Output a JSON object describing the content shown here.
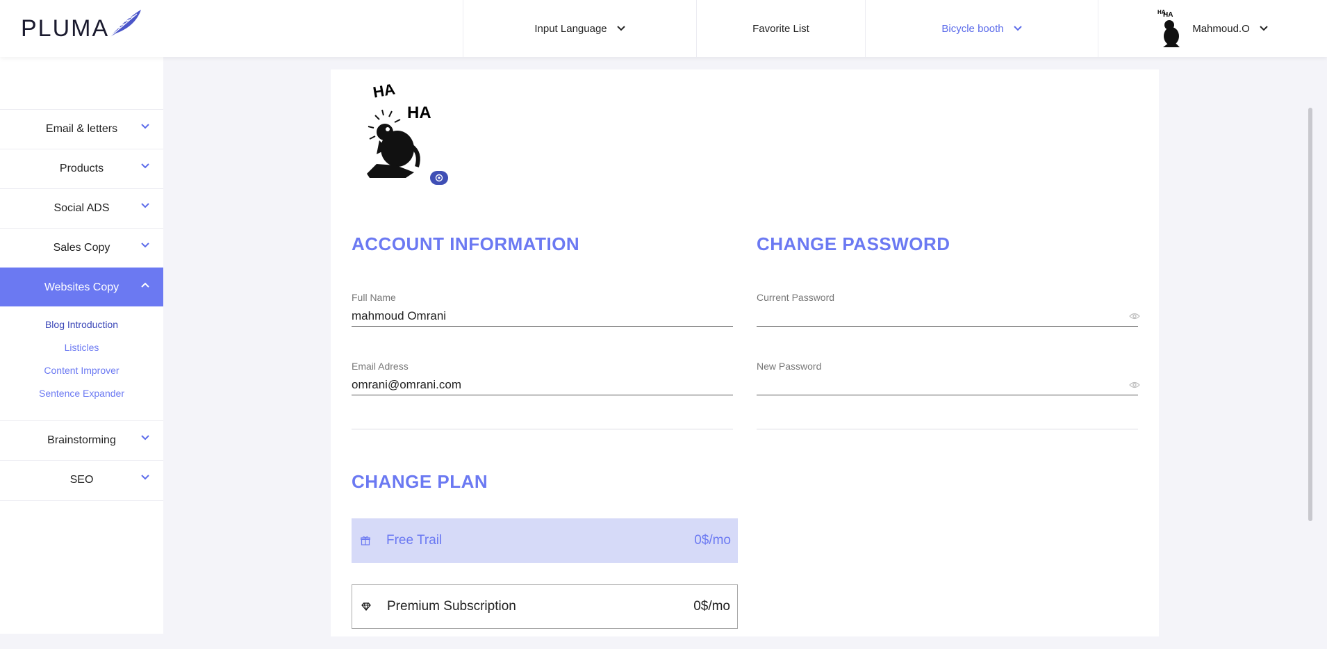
{
  "app": {
    "logo_text": "PLUMA"
  },
  "header": {
    "input_language": "Input Language",
    "favorite_list": "Favorite List",
    "bicycle_booth": "Bicycle booth",
    "user_name": "Mahmoud.O"
  },
  "sidebar": {
    "items": [
      {
        "label": "Email & letters"
      },
      {
        "label": "Products"
      },
      {
        "label": "Social ADS"
      },
      {
        "label": "Sales Copy"
      },
      {
        "label": "Websites Copy",
        "active": true
      },
      {
        "label": "Brainstorming"
      },
      {
        "label": "SEO"
      }
    ],
    "sub_items": [
      {
        "label": "Blog Introduction",
        "current": true
      },
      {
        "label": "Listicles"
      },
      {
        "label": "Content Improver"
      },
      {
        "label": "Sentence Expander"
      }
    ]
  },
  "account": {
    "title": "ACCOUNT INFORMATION",
    "full_name_label": "Full Name",
    "full_name_value": "mahmoud Omrani",
    "email_label": "Email Adress",
    "email_value": "omrani@omrani.com"
  },
  "password": {
    "title": "CHANGE PASSWORD",
    "current_label": "Current Password",
    "current_value": "",
    "new_label": "New Password",
    "new_value": ""
  },
  "plan": {
    "title": "CHANGE PLAN",
    "options": [
      {
        "name": "Free Trail",
        "price": "0$/mo",
        "selected": true
      },
      {
        "name": "Premium Subscription",
        "price": "0$/mo",
        "selected": false
      }
    ]
  },
  "colors": {
    "accent": "#6b79f2",
    "accent_dark": "#3b47b8",
    "selected_plan_bg": "#d6daf8"
  }
}
